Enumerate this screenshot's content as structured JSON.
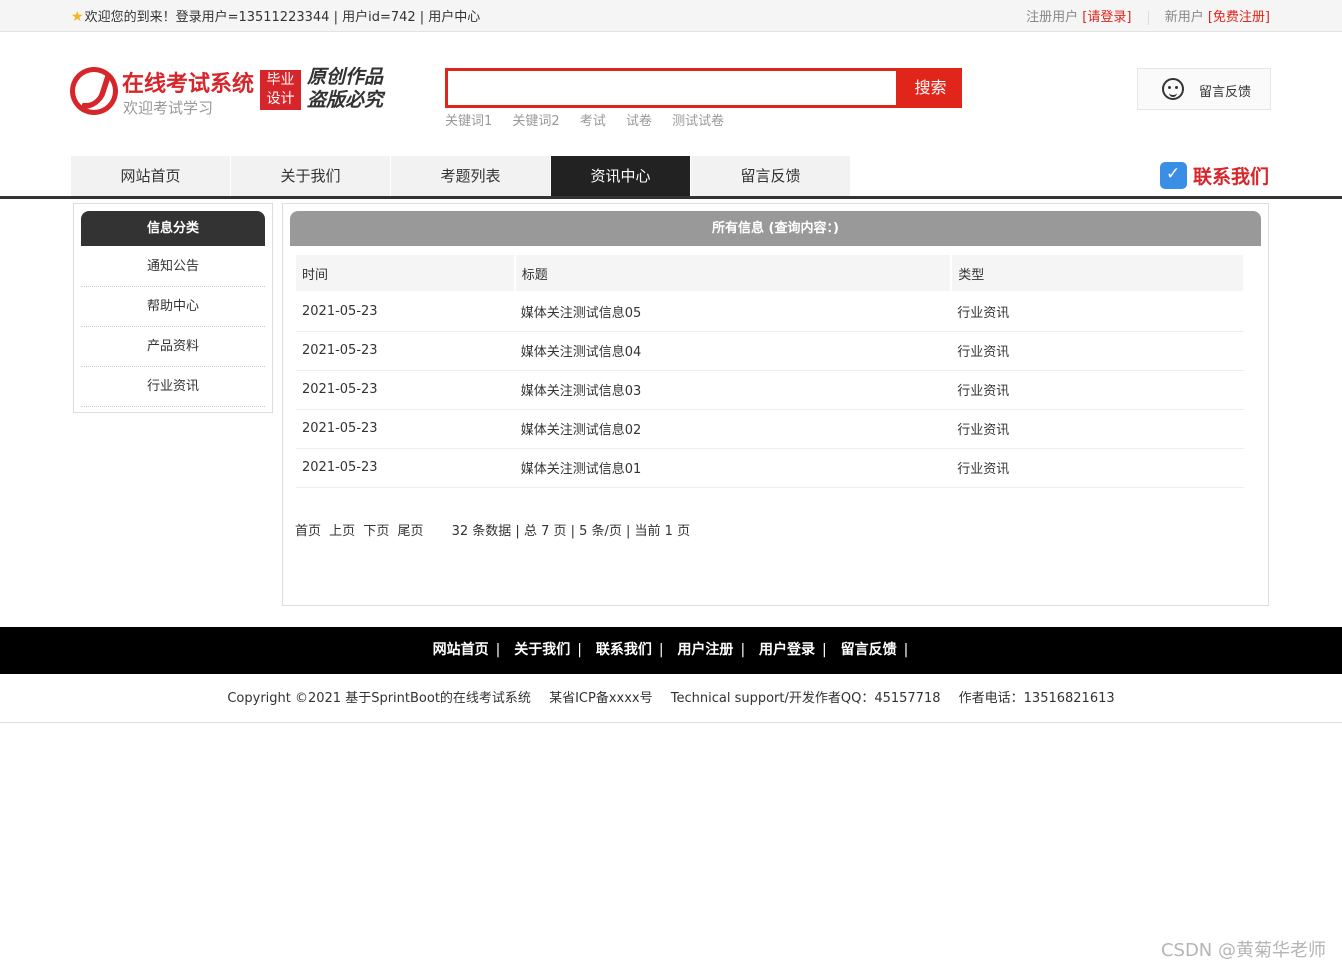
{
  "topbar": {
    "welcome": "欢迎您的到来！登录用户=13511223344 | 用户id=742 | 用户中心",
    "register_prefix": "注册用户",
    "login_link": "[请登录]",
    "new_user_prefix": "新用户",
    "signup_link": "[免费注册]"
  },
  "header": {
    "site_title": "在线考试系统",
    "site_subtitle": "欢迎考试学习",
    "badge_line1": "毕业",
    "badge_line2": "设计",
    "slogan_line1": "原创作品",
    "slogan_line2": "盗版必究",
    "search_placeholder": "",
    "search_button": "搜索",
    "keywords": [
      "关键词1",
      "关键词2",
      "考试",
      "试卷",
      "测试试卷"
    ],
    "feedback_label": "留言反馈",
    "contact_label": "联系我们"
  },
  "nav": {
    "items": [
      "网站首页",
      "关于我们",
      "考题列表",
      "资讯中心",
      "留言反馈"
    ],
    "active": "资讯中心"
  },
  "sidebar": {
    "title": "信息分类",
    "items": [
      "通知公告",
      "帮助中心",
      "产品资料",
      "行业资讯"
    ]
  },
  "main": {
    "title": "所有信息 (查询内容：)",
    "columns": [
      "时间",
      "标题",
      "类型"
    ],
    "rows": [
      {
        "time": "2021-05-23",
        "title": "媒体关注测试信息05",
        "type": "行业资讯"
      },
      {
        "time": "2021-05-23",
        "title": "媒体关注测试信息04",
        "type": "行业资讯"
      },
      {
        "time": "2021-05-23",
        "title": "媒体关注测试信息03",
        "type": "行业资讯"
      },
      {
        "time": "2021-05-23",
        "title": "媒体关注测试信息02",
        "type": "行业资讯"
      },
      {
        "time": "2021-05-23",
        "title": "媒体关注测试信息01",
        "type": "行业资讯"
      }
    ],
    "pager": {
      "first": "首页",
      "prev": "上页",
      "next": "下页",
      "last": "尾页",
      "stats": "32 条数据 | 总 7 页 | 5 条/页 | 当前 1 页"
    }
  },
  "footer": {
    "links": [
      "网站首页",
      "关于我们",
      "联系我们",
      "用户注册",
      "用户登录",
      "留言反馈"
    ],
    "copyright": "Copyright ©2021 基于SprintBoot的在线考试系统",
    "icp": "某省ICP备xxxx号",
    "support": "Technical support/开发作者QQ：45157718",
    "phone": "作者电话：13516821613"
  },
  "watermark": "CSDN @黄菊华老师",
  "colors": {
    "brand_red": "#e1251b",
    "nav_active": "#222222",
    "footer_bg": "#000000"
  }
}
